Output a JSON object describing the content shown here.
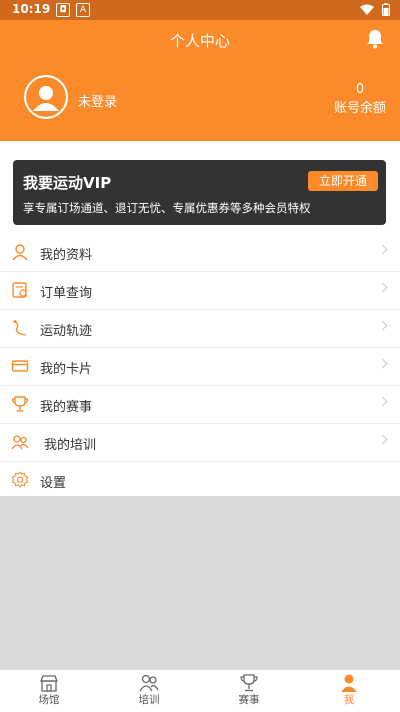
{
  "status_bar": {
    "time": "10:19",
    "icon_a": "A"
  },
  "header": {
    "title": "个人中心",
    "login_text": "未登录",
    "balance_value": "0",
    "balance_label": "账号余额"
  },
  "vip": {
    "title": "我要运动VIP",
    "button": "立即开通",
    "description": "享专属订场通道、退订无忧、专属优惠券等多种会员特权"
  },
  "menu": [
    {
      "label": "我的资料",
      "icon": "user-icon"
    },
    {
      "label": "订单查询",
      "icon": "order-icon"
    },
    {
      "label": "运动轨迹",
      "icon": "track-icon"
    },
    {
      "label": "我的卡片",
      "icon": "card-icon"
    },
    {
      "label": "我的赛事",
      "icon": "trophy-icon"
    },
    {
      "label": "我的培训",
      "icon": "training-icon"
    },
    {
      "label": "设置",
      "icon": "settings-icon"
    }
  ],
  "tabs": [
    {
      "label": "场馆",
      "icon": "venue-icon"
    },
    {
      "label": "培训",
      "icon": "training-icon"
    },
    {
      "label": "赛事",
      "icon": "trophy-icon"
    },
    {
      "label": "我",
      "icon": "profile-icon",
      "active": true
    }
  ],
  "colors": {
    "accent": "#fb8a2a",
    "status_bar": "#d0691b",
    "vip_bg": "#333333",
    "background": "#d9d9d9"
  }
}
